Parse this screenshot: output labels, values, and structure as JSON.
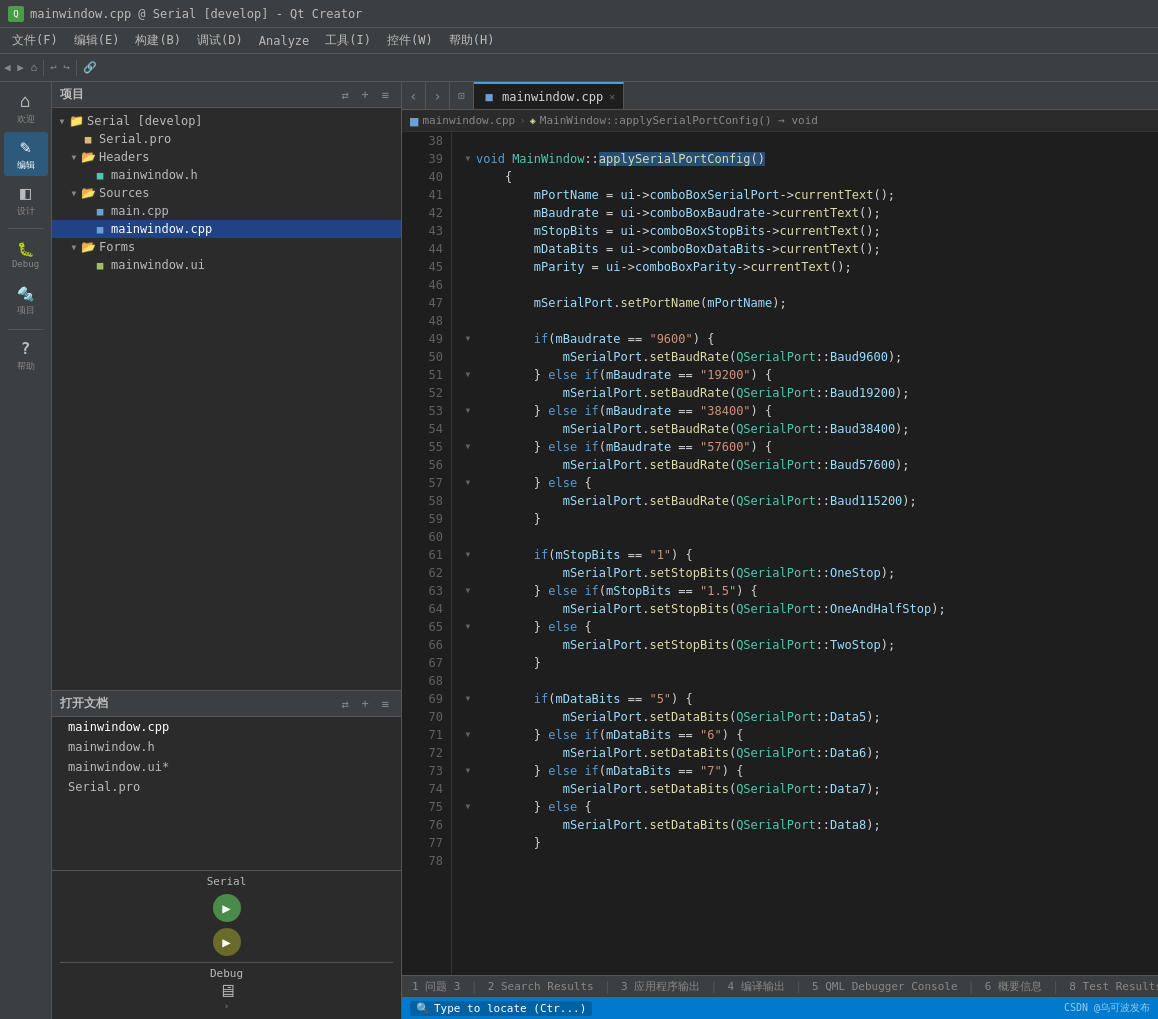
{
  "titlebar": {
    "title": "mainwindow.cpp @ Serial [develop] - Qt Creator"
  },
  "menubar": {
    "items": [
      "文件(F)",
      "编辑(E)",
      "构建(B)",
      "调试(D)",
      "Analyze",
      "工具(I)",
      "控件(W)",
      "帮助(H)"
    ]
  },
  "sidebar_icons": [
    {
      "id": "welcome",
      "label": "欢迎",
      "icon": "⌂"
    },
    {
      "id": "edit",
      "label": "编辑",
      "icon": "✎",
      "active": true
    },
    {
      "id": "design",
      "label": "设计",
      "icon": "◧"
    },
    {
      "id": "debug",
      "label": "Debug",
      "icon": "🔧"
    },
    {
      "id": "project",
      "label": "项目",
      "icon": "🔩"
    },
    {
      "id": "help",
      "label": "帮助",
      "icon": "?"
    }
  ],
  "project_panel": {
    "title": "项目",
    "tree": [
      {
        "indent": 0,
        "arrow": "▼",
        "icon": "folder",
        "label": "Serial [develop]",
        "type": "folder-project"
      },
      {
        "indent": 1,
        "arrow": "",
        "icon": "pro",
        "label": "Serial.pro",
        "type": "file-pro"
      },
      {
        "indent": 1,
        "arrow": "▼",
        "icon": "folder",
        "label": "Headers",
        "type": "folder"
      },
      {
        "indent": 2,
        "arrow": "",
        "icon": "h",
        "label": "mainwindow.h",
        "type": "file-h"
      },
      {
        "indent": 1,
        "arrow": "▼",
        "icon": "folder",
        "label": "Sources",
        "type": "folder"
      },
      {
        "indent": 2,
        "arrow": "",
        "icon": "cpp",
        "label": "main.cpp",
        "type": "file-cpp"
      },
      {
        "indent": 2,
        "arrow": "",
        "icon": "cpp",
        "label": "mainwindow.cpp",
        "type": "file-cpp",
        "selected": true
      },
      {
        "indent": 1,
        "arrow": "▼",
        "icon": "folder",
        "label": "Forms",
        "type": "folder"
      },
      {
        "indent": 2,
        "arrow": "",
        "icon": "ui",
        "label": "mainwindow.ui",
        "type": "file-ui"
      }
    ]
  },
  "open_docs": {
    "title": "打开文档",
    "items": [
      {
        "label": "mainwindow.cpp",
        "active": true
      },
      {
        "label": "mainwindow.h",
        "active": false
      },
      {
        "label": "mainwindow.ui*",
        "active": false
      },
      {
        "label": "Serial.pro",
        "active": false
      }
    ]
  },
  "serial_panel": {
    "label": "Serial",
    "debug_label": "Debug"
  },
  "tab_bar": {
    "active_tab": "mainwindow.cpp",
    "tabs": [
      {
        "label": "mainwindow.cpp",
        "active": true
      }
    ],
    "breadcrumb": "MainWindow::applySerialPortConfig() → void"
  },
  "code": {
    "lines": [
      {
        "num": 38,
        "fold": false,
        "content": ""
      },
      {
        "num": 39,
        "fold": true,
        "content_parts": [
          {
            "t": "kw",
            "v": "void"
          },
          {
            "t": "plain",
            "v": " "
          },
          {
            "t": "cls",
            "v": "MainWindow"
          },
          {
            "t": "plain",
            "v": "::"
          },
          {
            "t": "fn-hl",
            "v": "applySerialPortConfig"
          },
          {
            "t": "plain",
            "v": "()"
          }
        ]
      },
      {
        "num": 40,
        "fold": false,
        "content_raw": "    {"
      },
      {
        "num": 41,
        "fold": false,
        "content_raw": "        mPortName = ui->comboBoxSerialPort->currentText();"
      },
      {
        "num": 42,
        "fold": false,
        "content_raw": "        mBaudrate = ui->comboBoxBaudrate->currentText();"
      },
      {
        "num": 43,
        "fold": false,
        "content_raw": "        mStopBits = ui->comboBoxStopBits->currentText();"
      },
      {
        "num": 44,
        "fold": false,
        "content_raw": "        mDataBits = ui->comboBoxDataBits->currentText();"
      },
      {
        "num": 45,
        "fold": false,
        "content_raw": "        mParity = ui->comboBoxParity->currentText();"
      },
      {
        "num": 46,
        "fold": false,
        "content_raw": ""
      },
      {
        "num": 47,
        "fold": false,
        "content_raw": "        mSerialPort.setPortName(mPortName);"
      },
      {
        "num": 48,
        "fold": false,
        "content_raw": ""
      },
      {
        "num": 49,
        "fold": true,
        "content_raw": "        if(mBaudrate == \"9600\") {"
      },
      {
        "num": 50,
        "fold": false,
        "content_raw": "            mSerialPort.setBaudRate(QSerialPort::Baud9600);"
      },
      {
        "num": 51,
        "fold": true,
        "content_raw": "        } else if(mBaudrate == \"19200\") {"
      },
      {
        "num": 52,
        "fold": false,
        "content_raw": "            mSerialPort.setBaudRate(QSerialPort::Baud19200);"
      },
      {
        "num": 53,
        "fold": true,
        "content_raw": "        } else if(mBaudrate == \"38400\") {"
      },
      {
        "num": 54,
        "fold": false,
        "content_raw": "            mSerialPort.setBaudRate(QSerialPort::Baud38400);"
      },
      {
        "num": 55,
        "fold": true,
        "content_raw": "        } else if(mBaudrate == \"57600\") {"
      },
      {
        "num": 56,
        "fold": false,
        "content_raw": "            mSerialPort.setBaudRate(QSerialPort::Baud57600);"
      },
      {
        "num": 57,
        "fold": true,
        "content_raw": "        } else {"
      },
      {
        "num": 58,
        "fold": false,
        "content_raw": "            mSerialPort.setBaudRate(QSerialPort::Baud115200);"
      },
      {
        "num": 59,
        "fold": false,
        "content_raw": "        }"
      },
      {
        "num": 60,
        "fold": false,
        "content_raw": ""
      },
      {
        "num": 61,
        "fold": true,
        "content_raw": "        if(mStopBits == \"1\") {"
      },
      {
        "num": 62,
        "fold": false,
        "content_raw": "            mSerialPort.setStopBits(QSerialPort::OneStop);"
      },
      {
        "num": 63,
        "fold": true,
        "content_raw": "        } else if(mStopBits == \"1.5\") {"
      },
      {
        "num": 64,
        "fold": false,
        "content_raw": "            mSerialPort.setStopBits(QSerialPort::OneAndHalfStop);"
      },
      {
        "num": 65,
        "fold": true,
        "content_raw": "        } else {"
      },
      {
        "num": 66,
        "fold": false,
        "content_raw": "            mSerialPort.setStopBits(QSerialPort::TwoStop);"
      },
      {
        "num": 67,
        "fold": false,
        "content_raw": "        }"
      },
      {
        "num": 68,
        "fold": false,
        "content_raw": ""
      },
      {
        "num": 69,
        "fold": true,
        "content_raw": "        if(mDataBits == \"5\") {"
      },
      {
        "num": 70,
        "fold": false,
        "content_raw": "            mSerialPort.setDataBits(QSerialPort::Data5);"
      },
      {
        "num": 71,
        "fold": true,
        "content_raw": "        } else if(mDataBits == \"6\") {"
      },
      {
        "num": 72,
        "fold": false,
        "content_raw": "            mSerialPort.setDataBits(QSerialPort::Data6);"
      },
      {
        "num": 73,
        "fold": true,
        "content_raw": "        } else if(mDataBits == \"7\") {"
      },
      {
        "num": 74,
        "fold": false,
        "content_raw": "            mSerialPort.setDataBits(QSerialPort::Data7);"
      },
      {
        "num": 75,
        "fold": true,
        "content_raw": "        } else {"
      },
      {
        "num": 76,
        "fold": false,
        "content_raw": "            mSerialPort.setDataBits(QSerialPort::Data8);"
      },
      {
        "num": 77,
        "fold": false,
        "content_raw": "        }"
      },
      {
        "num": 78,
        "fold": false,
        "content_raw": ""
      }
    ]
  },
  "status_bar": {
    "items": [
      "1 问题 3",
      "2 Search Results",
      "3 应用程序输出",
      "4 编译输出",
      "5 QML Debugger Console",
      "6 概要信息",
      "8 Test Results"
    ]
  }
}
